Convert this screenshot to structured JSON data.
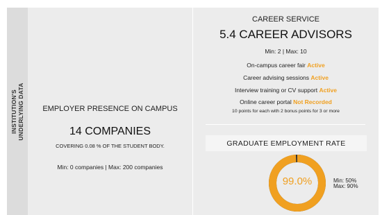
{
  "sidebar": {
    "label_line1": "INSTITUTION'S",
    "label_line2": "UNDERLYING DATA"
  },
  "employer_presence": {
    "title": "EMPLOYER PRESENCE ON CAMPUS",
    "value": "14 COMPANIES",
    "coverage": "COVERING 0.08 % OF THE STUDENT BODY.",
    "range": "Min: 0 companies | Max: 200 companies"
  },
  "career_service": {
    "title": "CAREER SERVICE",
    "value": "5.4 CAREER ADVISORS",
    "range": "Min: 2 | Max: 10",
    "items": [
      {
        "label": "On-campus career fair",
        "status": "Active"
      },
      {
        "label": "Career advising sessions",
        "status": "Active"
      },
      {
        "label": "Interview training or CV support",
        "status": "Active"
      },
      {
        "label": "Online career portal",
        "status": "Not Recorded"
      }
    ],
    "note": "10 points for each with 2 bonus points for 3 or more"
  },
  "graduate_employment": {
    "title": "GRADUATE EMPLOYMENT RATE",
    "value_label": "99.0%",
    "percent": 99.0,
    "min": "Min: 50%",
    "max": "Max: 90%"
  },
  "colors": {
    "accent": "#f0a021",
    "panel": "#ececec",
    "sidebar": "#dcdcdc",
    "remainder": "#333333"
  }
}
